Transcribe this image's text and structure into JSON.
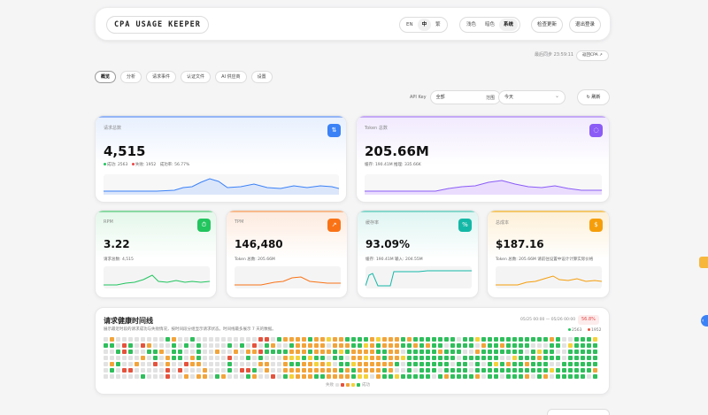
{
  "header": {
    "brand": "CPA USAGE KEEPER",
    "language": [
      "EN",
      "中",
      "繁"
    ],
    "language_selected": "中",
    "theme": [
      "浅色",
      "暗色",
      "系统"
    ],
    "theme_selected": "系统",
    "check_update": "检查更新",
    "logout": "退出登录"
  },
  "status": {
    "last_sync": "最后同步 23:59:11",
    "back_link": "返回CPA"
  },
  "tabs": [
    "概览",
    "分析",
    "请求事件",
    "认证文件",
    "AI 供应商",
    "设置"
  ],
  "tab_selected": "概览",
  "filters": {
    "api_key_label": "API Key",
    "api_key_value": "全部",
    "range_label": "范围",
    "range_value": "今天",
    "refresh": "刷新"
  },
  "cards": {
    "requests": {
      "label": "请求总数",
      "value": "4,515",
      "success": "成功: 2563",
      "fail": "失败: 1952",
      "rate": "成功率: 56.77%"
    },
    "tokens": {
      "label": "Token 总数",
      "value": "205.66M",
      "sub": "缓存: 190.41M   推理: 335.66K"
    },
    "rpm": {
      "label": "RPM",
      "value": "3.22",
      "sub": "请求总数: 4,515"
    },
    "tpm": {
      "label": "TPM",
      "value": "146,480",
      "sub": "Token 总数: 205.66M"
    },
    "cache": {
      "label": "缓存率",
      "value": "93.09%",
      "sub": "缓存: 190.41M   输入: 204.55M"
    },
    "cost": {
      "label": "总成本",
      "value": "$187.16",
      "sub": "Token 总数: 205.66M   请前往设置中设计计算实际价格"
    }
  },
  "colors": {
    "blue": "#3b82f6",
    "purple": "#8b5cf6",
    "green": "#22c55e",
    "orange": "#f97316",
    "teal": "#14b8a6",
    "amber": "#f59e0b",
    "cell_green": "#2fbf5c",
    "cell_orange": "#f2a43a",
    "cell_yellow": "#f3d23b",
    "cell_red": "#e5533d",
    "cell_gray": "#e2e2e2"
  },
  "health": {
    "title": "请求健康时间线",
    "desc": "展示最近时段的请求成功与失败情况，按时间段分组显示请求状态。时间线最多展示 7 天的数据。",
    "range": "05/25 00:00 — 05/26 00:00",
    "rate": "56.8%",
    "legend_success": "2563",
    "legend_fail": "1952",
    "foot_left": "失败",
    "foot_right": "成功"
  }
}
